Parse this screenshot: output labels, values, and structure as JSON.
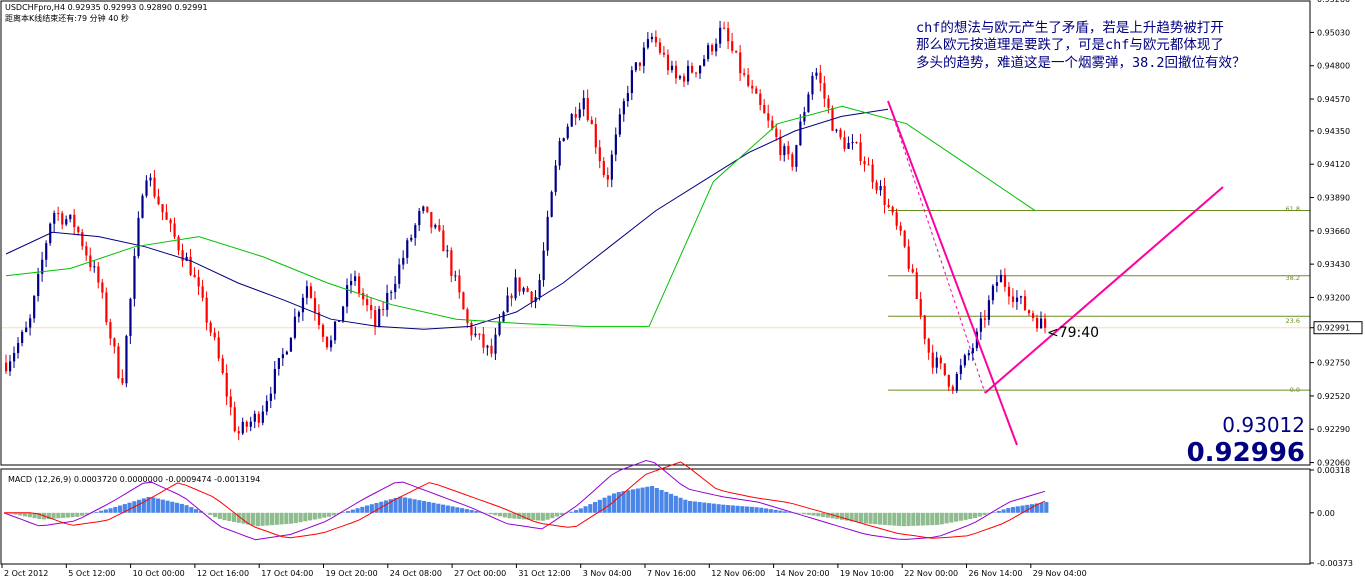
{
  "header": {
    "symbol_line": "USDCHFpro,H4  0.92935 0.92993 0.92890 0.92991",
    "timer_line": "距离本K线结束还有:79 分钟 40 秒"
  },
  "annotation_lines": [
    "chf的想法与欧元产生了矛盾，若是上升趋势被打开",
    "那么欧元按道理是要跌了，可是chf与欧元都体现了",
    "多头的趋势，难道这是一个烟雾弹，38.2回撤位有效？"
  ],
  "big_prices": {
    "line1": "0.93012",
    "line2": "0.92996"
  },
  "countdown": "<79:40",
  "current_price_label": "0.92991",
  "fib_labels": [
    "61.8",
    "38.2",
    "23.6",
    "0.0"
  ],
  "macd_header": "MACD (12,26,9) 0.0003720 0.0000000 -0.0009474 -0.0013194",
  "colors": {
    "bull": "#00008b",
    "bear": "#ff0000",
    "ma_fast": "#000080",
    "ma_slow": "#00c000",
    "trend": "#ff00a0",
    "fib": "#6b8e23",
    "macd_pos": "#4a86e8",
    "macd_neg": "#8fbc8f",
    "macd_line": "#9400d3",
    "macd_signal": "#ff0000",
    "price_line": "#f5deb3",
    "text_accent": "#000080"
  },
  "chart_data": [
    {
      "type": "candlestick",
      "title": "USDCHFpro,H4",
      "ylim": [
        0.9205,
        0.9524
      ],
      "y_ticks": [
        "0.95260",
        "0.95030",
        "0.94800",
        "0.94570",
        "0.94350",
        "0.94120",
        "0.93890",
        "0.93660",
        "0.93430",
        "0.93200",
        "0.92991",
        "0.92750",
        "0.92520",
        "0.92290",
        "0.92060"
      ],
      "x_ticks": [
        "2 Oct 2012",
        "5 Oct 12:00",
        "10 Oct 00:00",
        "12 Oct 16:00",
        "17 Oct 04:00",
        "19 Oct 20:00",
        "24 Oct 08:00",
        "27 Oct 00:00",
        "31 Oct 12:00",
        "3 Nov 04:00",
        "7 Nov 16:00",
        "12 Nov 06:00",
        "14 Nov 20:00",
        "19 Nov 10:00",
        "22 Nov 00:00",
        "26 Nov 14:00",
        "29 Nov 04:00"
      ],
      "ohlc_anchor": [
        0.9275,
        0.93,
        0.938,
        0.937,
        0.933,
        0.926,
        0.941,
        0.937,
        0.934,
        0.929,
        0.9225,
        0.924,
        0.928,
        0.933,
        0.9285,
        0.9335,
        0.93,
        0.934,
        0.938,
        0.9355,
        0.93,
        0.928,
        0.933,
        0.932,
        0.943,
        0.946,
        0.94,
        0.947,
        0.95,
        0.947,
        0.948,
        0.9505,
        0.947,
        0.944,
        0.941,
        0.948,
        0.943,
        0.942,
        0.939,
        0.935,
        0.928,
        0.926,
        0.929,
        0.9335,
        0.9315,
        0.9299
      ],
      "last_bar": {
        "open": 0.92935,
        "high": 0.92993,
        "low": 0.9289,
        "close": 0.92991
      },
      "moving_averages": [
        {
          "name": "fast",
          "values": [
            0.935,
            0.9365,
            0.9362,
            0.9355,
            0.9345,
            0.933,
            0.9318,
            0.9305,
            0.93,
            0.9298,
            0.93,
            0.931,
            0.933,
            0.9355,
            0.938,
            0.94,
            0.942,
            0.9435,
            0.9445,
            0.945
          ]
        },
        {
          "name": "slow",
          "values": [
            0.9335,
            0.934,
            0.9355,
            0.9362,
            0.9348,
            0.933,
            0.9315,
            0.9305,
            0.9302,
            0.93,
            0.93
          ]
        }
      ],
      "fibonacci": [
        {
          "level": "61.8",
          "price": 0.938
        },
        {
          "level": "38.2",
          "price": 0.9335
        },
        {
          "level": "23.6",
          "price": 0.9307
        },
        {
          "level": "0.0",
          "price": 0.9256
        }
      ]
    },
    {
      "type": "macd",
      "title": "MACD (12,26,9)",
      "ylim": [
        -0.00373,
        0.00318
      ],
      "y_ticks": [
        "0.00318",
        "0.00",
        "-0.00373"
      ],
      "histogram_shape": [
        0.0,
        -0.0005,
        -0.0003,
        0.0004,
        0.0012,
        0.0006,
        -0.0005,
        -0.001,
        -0.0008,
        -0.0003,
        0.0005,
        0.0012,
        0.0007,
        0.0002,
        -0.0004,
        -0.0006,
        0.0003,
        0.0015,
        0.002,
        0.0009,
        0.0006,
        0.0004,
        0.0,
        -0.0004,
        -0.0008,
        -0.001,
        -0.0009,
        -0.0004,
        0.0004,
        0.0008
      ]
    }
  ]
}
